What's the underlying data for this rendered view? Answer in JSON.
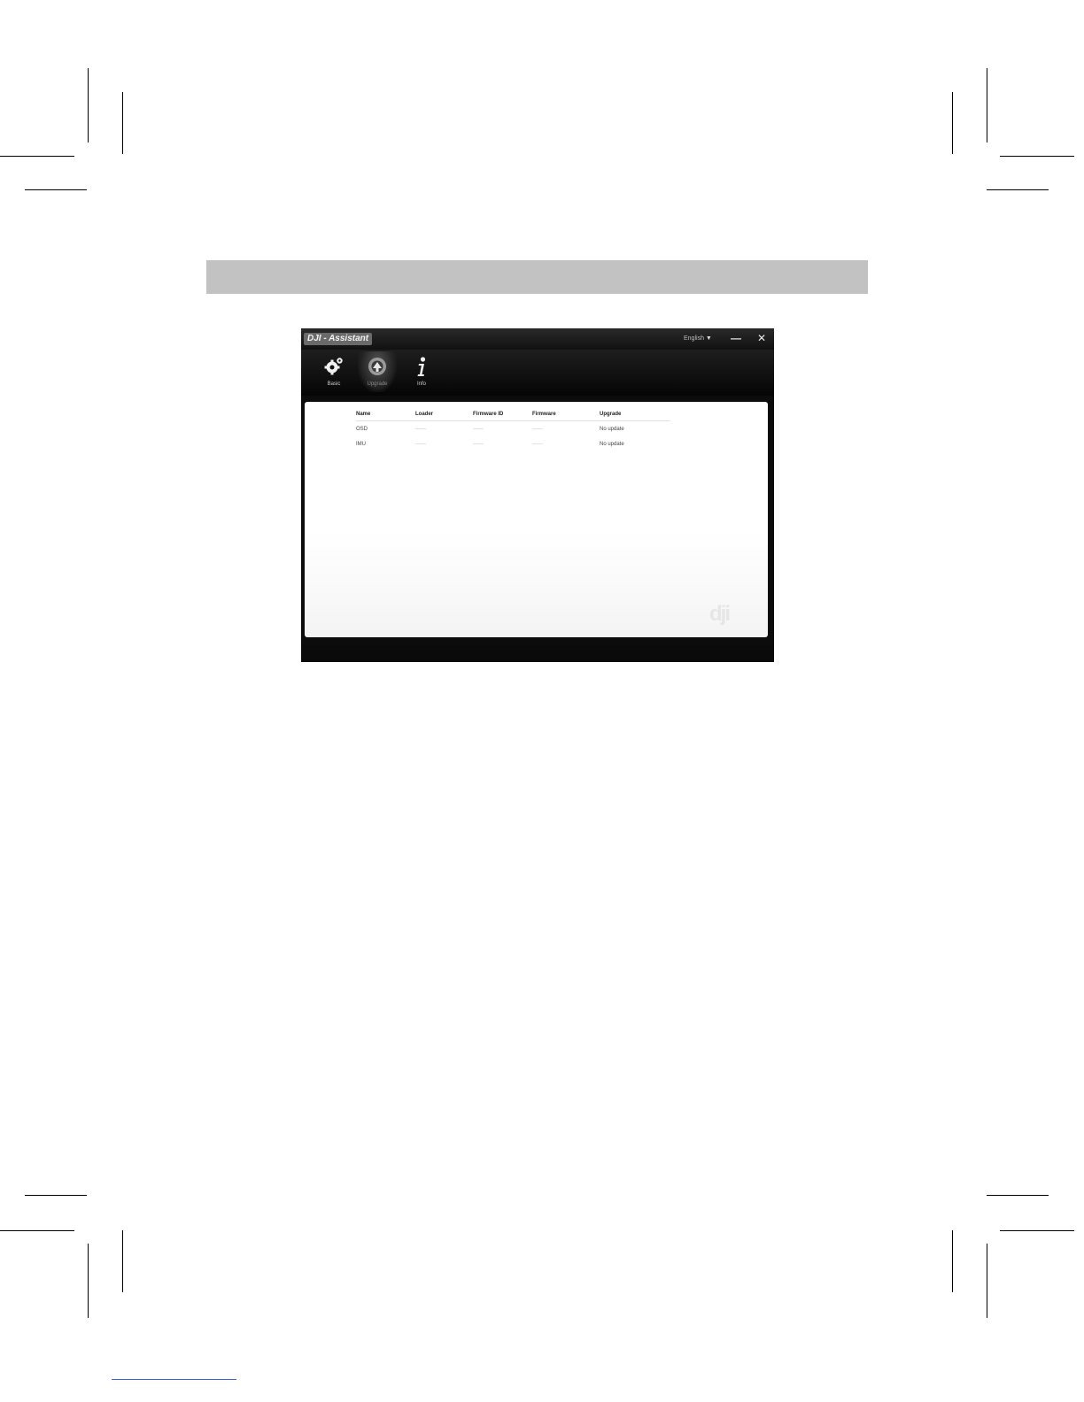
{
  "window": {
    "title": "DJI - Assistant",
    "language": "English",
    "language_caret": "▼",
    "minimize": "—",
    "close": "✕"
  },
  "toolbar": {
    "items": [
      {
        "label": "Basic",
        "icon": "gear-icon"
      },
      {
        "label": "Upgrade",
        "icon": "upgrade-icon"
      },
      {
        "label": "Info",
        "icon": "info-icon"
      }
    ]
  },
  "firmware_table": {
    "headers": [
      "Name",
      "Loader",
      "Firmware ID",
      "Firmware",
      "Upgrade"
    ],
    "rows": [
      [
        "OSD",
        "------",
        "------",
        "------",
        "No update"
      ],
      [
        "IMU",
        "------",
        "------",
        "------",
        "No update"
      ]
    ]
  },
  "watermark": "dji"
}
